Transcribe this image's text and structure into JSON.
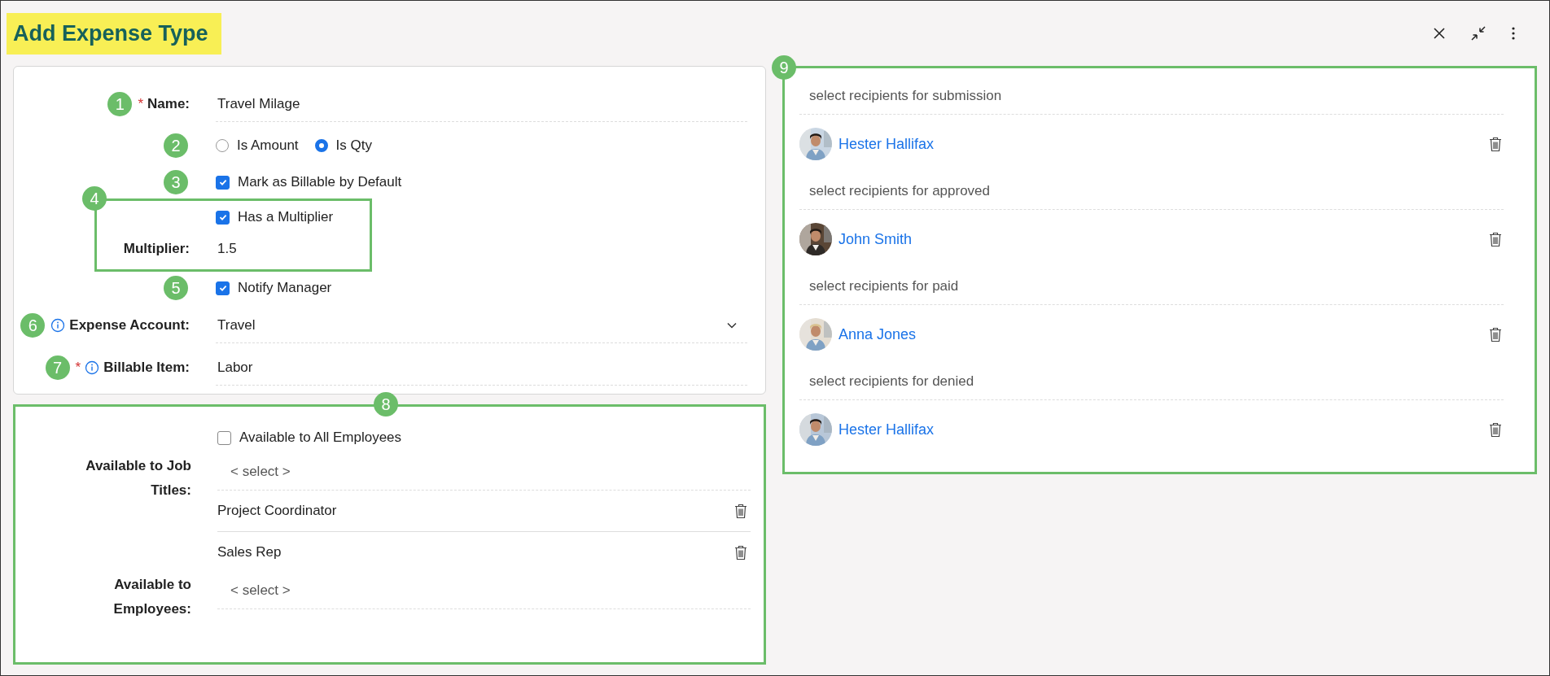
{
  "title": "Add Expense Type",
  "form": {
    "name": {
      "badge": "1",
      "required_mark": "*",
      "label": "Name:",
      "value": "Travel Milage"
    },
    "amount_type": {
      "badge": "2",
      "options": [
        {
          "label": "Is Amount",
          "selected": false
        },
        {
          "label": "Is Qty",
          "selected": true
        }
      ]
    },
    "billable_default": {
      "badge": "3",
      "label": "Mark as Billable by Default",
      "checked": true
    },
    "multiplier_group": {
      "badge": "4",
      "has_multiplier": {
        "label": "Has a Multiplier",
        "checked": true
      },
      "label": "Multiplier:",
      "value": "1.5"
    },
    "notify_manager": {
      "badge": "5",
      "label": "Notify Manager",
      "checked": true
    },
    "expense_account": {
      "badge": "6",
      "label": "Expense Account:",
      "value": "Travel"
    },
    "billable_item": {
      "badge": "7",
      "required_mark": "*",
      "label": "Billable Item:",
      "value": "Labor"
    }
  },
  "availability": {
    "badge": "8",
    "all_employees": {
      "label": "Available to All Employees",
      "checked": false
    },
    "job_titles": {
      "label": "Available to Job Titles:",
      "placeholder": "< select >",
      "items": [
        "Project Coordinator",
        "Sales Rep"
      ]
    },
    "employees": {
      "label": "Available to Employees:",
      "placeholder": "< select >"
    }
  },
  "notifications": {
    "badge": "9",
    "groups": [
      {
        "placeholder": "select recipients for submission",
        "recipients": [
          "Hester Hallifax"
        ]
      },
      {
        "placeholder": "select recipients for approved",
        "recipients": [
          "John Smith"
        ]
      },
      {
        "placeholder": "select recipients for paid",
        "recipients": [
          "Anna Jones"
        ]
      },
      {
        "placeholder": "select recipients for denied",
        "recipients": [
          "Hester Hallifax"
        ]
      }
    ]
  }
}
